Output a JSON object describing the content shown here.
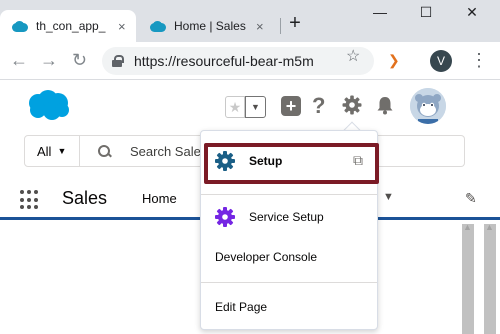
{
  "browser": {
    "tabs": [
      {
        "label": "th_con_app_",
        "close": "×"
      },
      {
        "label": "Home | Sales",
        "close": "×"
      }
    ],
    "new_tab": "+",
    "window": {
      "minimize": "—",
      "maximize": "☐",
      "close": "✕"
    },
    "nav": {
      "back": "←",
      "forward": "→",
      "reload": "↻"
    },
    "url": "https://resourceful-bear-m5m",
    "bookmark": "☆",
    "extension": "❯",
    "profile_initial": "V",
    "menu": "⋮"
  },
  "sf_header": {
    "favorites_star": "★",
    "favorites_dropdown": "▼",
    "add": "+",
    "help": "?",
    "search_scope": "All",
    "search_scope_caret": "▼",
    "search_placeholder": "Search Sale"
  },
  "sf_nav": {
    "app_name": "Sales",
    "items": [
      {
        "label": "Home"
      }
    ],
    "more_caret": "▼",
    "edit": "✎"
  },
  "setup_menu": {
    "items": [
      {
        "label": "Setup",
        "icon": "setup-gear-icon",
        "external": "⧉"
      },
      {
        "label": "Service Setup",
        "icon": "service-setup-gear-icon"
      },
      {
        "label": "Developer Console"
      },
      {
        "label": "Edit Page"
      }
    ],
    "highlight_color": "#7b1b26"
  },
  "colors": {
    "salesforce_blue": "#00a1e0",
    "setup_gear": "#1b5f86",
    "service_gear": "#7526e3",
    "nav_underline": "#1b5297"
  }
}
